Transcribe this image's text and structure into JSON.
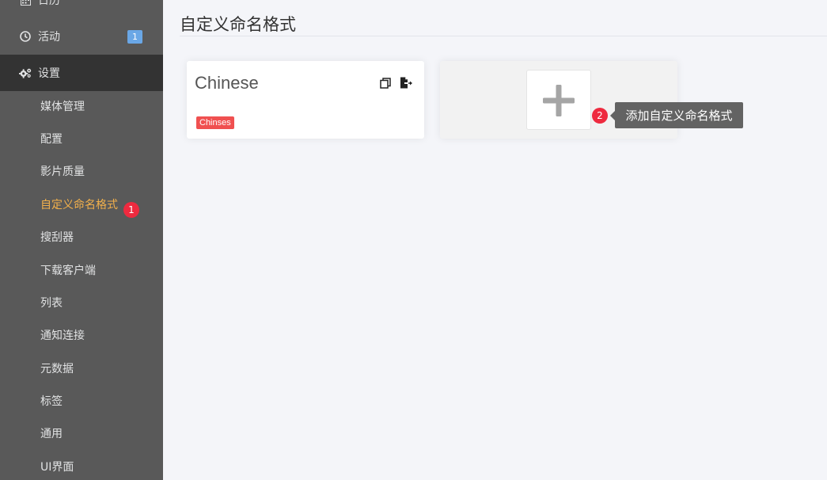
{
  "sidebar": {
    "calendar_label": "日历",
    "activity_label": "活动",
    "activity_count": "1",
    "settings_label": "设置",
    "settings_items": [
      {
        "label": "媒体管理"
      },
      {
        "label": "配置"
      },
      {
        "label": "影片质量"
      },
      {
        "label": "自定义命名格式"
      },
      {
        "label": "搜刮器"
      },
      {
        "label": "下载客户端"
      },
      {
        "label": "列表"
      },
      {
        "label": "通知连接"
      },
      {
        "label": "元数据"
      },
      {
        "label": "标签"
      },
      {
        "label": "通用"
      },
      {
        "label": "UI界面"
      }
    ]
  },
  "markers": {
    "first": "1",
    "second": "2"
  },
  "main": {
    "page_title": "自定义命名格式",
    "card": {
      "title": "Chinese",
      "tag": "Chinses"
    },
    "add_tooltip": "添加自定义命名格式"
  },
  "colors": {
    "accent": "#f2b04b",
    "marker": "#ee2a3f",
    "badge": "#6aa7e6",
    "tag": "#f05050"
  }
}
